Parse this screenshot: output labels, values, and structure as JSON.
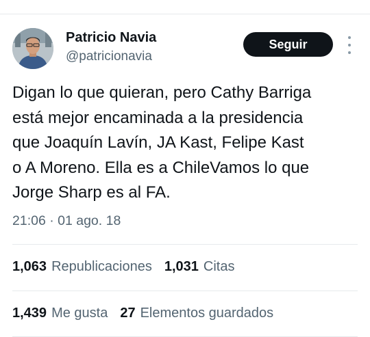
{
  "author": {
    "display_name": "Patricio Navia",
    "handle": "@patricionavia"
  },
  "follow_label": "Seguir",
  "tweet": {
    "text": "Digan lo que quieran, pero Cathy Barriga\nestá mejor encaminada a la presidencia\nque Joaquín Lavín, JA Kast, Felipe Kast\no A Moreno. Ella es a ChileVamos lo que\nJorge Sharp es al FA."
  },
  "timestamp": "21:06 · 01 ago. 18",
  "stats": {
    "retweets": {
      "count": "1,063",
      "label": "Republicaciones"
    },
    "quotes": {
      "count": "1,031",
      "label": "Citas"
    },
    "likes": {
      "count": "1,439",
      "label": "Me gusta"
    },
    "bookmarks": {
      "count": "27",
      "label": "Elementos guardados"
    }
  },
  "colors": {
    "text_primary": "#0f1419",
    "text_secondary": "#536471",
    "button_bg": "#0f1419",
    "divider": "#e6e9ec"
  },
  "icons": {
    "more": "more-vertical-icon"
  }
}
